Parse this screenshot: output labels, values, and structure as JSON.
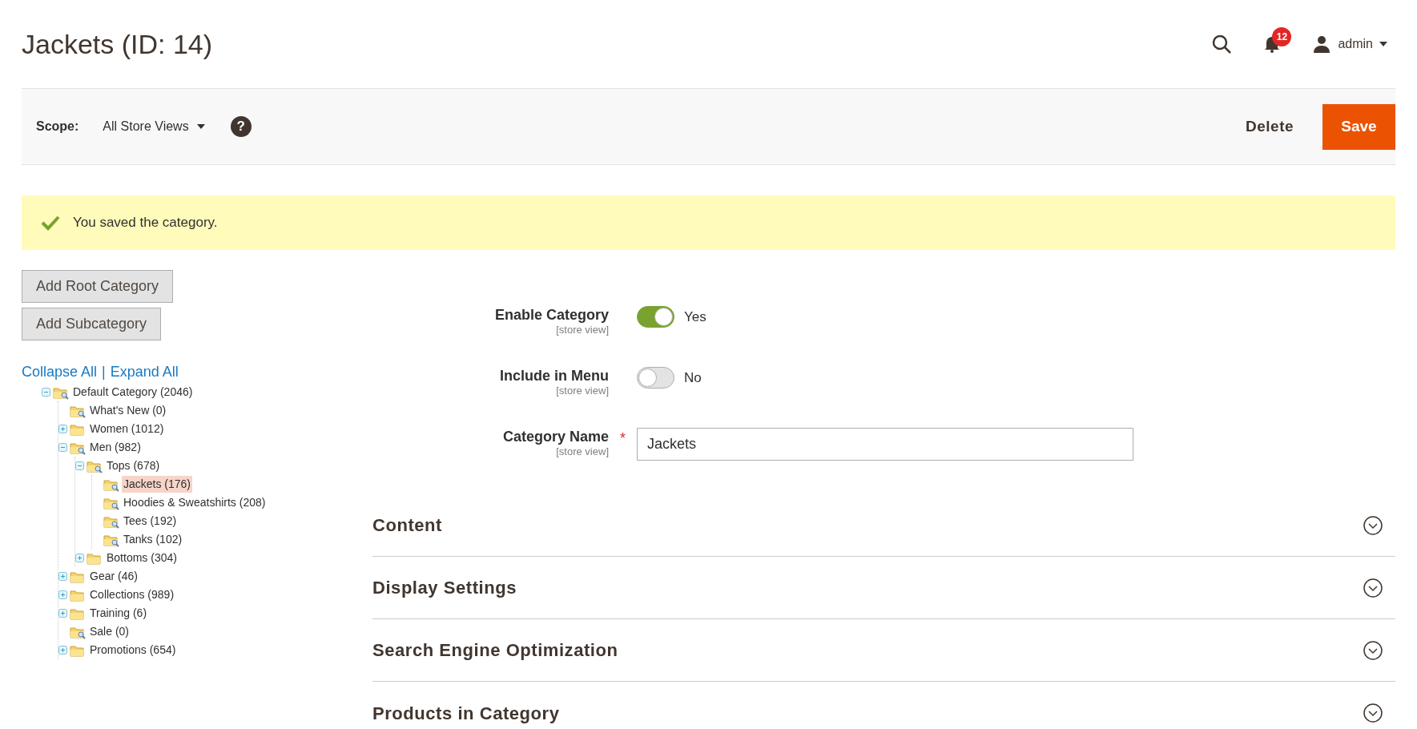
{
  "page_title": "Jackets (ID: 14)",
  "header": {
    "notifications": "12",
    "user": "admin"
  },
  "toolbar": {
    "scope_label": "Scope:",
    "scope_value": "All Store Views",
    "help": "?",
    "delete": "Delete",
    "save": "Save"
  },
  "message": "You saved the category.",
  "tree_buttons": [
    "Add Root Category",
    "Add Subcategory"
  ],
  "tree_links": {
    "collapse": "Collapse All",
    "separator": "|",
    "expand": "Expand All"
  },
  "tree": [
    {
      "label": "Default Category (2046)",
      "kind": "folder",
      "expanded": true,
      "selected": false,
      "children": [
        {
          "label": "What's New (0)",
          "kind": "leaf",
          "selected": false
        },
        {
          "label": "Women (1012)",
          "kind": "folder",
          "expanded": false,
          "selected": false
        },
        {
          "label": "Men (982)",
          "kind": "folder",
          "expanded": true,
          "selected": false,
          "children": [
            {
              "label": "Tops (678)",
              "kind": "folder",
              "expanded": true,
              "selected": false,
              "children": [
                {
                  "label": "Jackets (176)",
                  "kind": "leaf",
                  "selected": true
                },
                {
                  "label": "Hoodies & Sweatshirts (208)",
                  "kind": "leaf",
                  "selected": false
                },
                {
                  "label": "Tees (192)",
                  "kind": "leaf",
                  "selected": false
                },
                {
                  "label": "Tanks (102)",
                  "kind": "leaf",
                  "selected": false
                }
              ]
            },
            {
              "label": "Bottoms (304)",
              "kind": "folder",
              "expanded": false,
              "selected": false
            }
          ]
        },
        {
          "label": "Gear (46)",
          "kind": "folder",
          "expanded": false,
          "selected": false
        },
        {
          "label": "Collections (989)",
          "kind": "folder",
          "expanded": false,
          "selected": false
        },
        {
          "label": "Training (6)",
          "kind": "folder",
          "expanded": false,
          "selected": false
        },
        {
          "label": "Sale (0)",
          "kind": "leaf",
          "selected": false
        },
        {
          "label": "Promotions (654)",
          "kind": "folder",
          "expanded": false,
          "selected": false
        }
      ]
    }
  ],
  "fields": [
    {
      "kind": "toggle",
      "label": "Enable Category",
      "scope": "[store view]",
      "on": true,
      "value": "Yes"
    },
    {
      "kind": "toggle",
      "label": "Include in Menu",
      "scope": "[store view]",
      "on": false,
      "value": "No"
    },
    {
      "kind": "text",
      "label": "Category Name",
      "scope": "[store view]",
      "required": true,
      "required_mark": "*",
      "value": "Jackets"
    }
  ],
  "sections": [
    {
      "title": "Content",
      "expanded": false
    },
    {
      "title": "Display Settings",
      "expanded": false
    },
    {
      "title": "Search Engine Optimization",
      "expanded": false
    },
    {
      "title": "Products in Category",
      "expanded": false
    }
  ]
}
